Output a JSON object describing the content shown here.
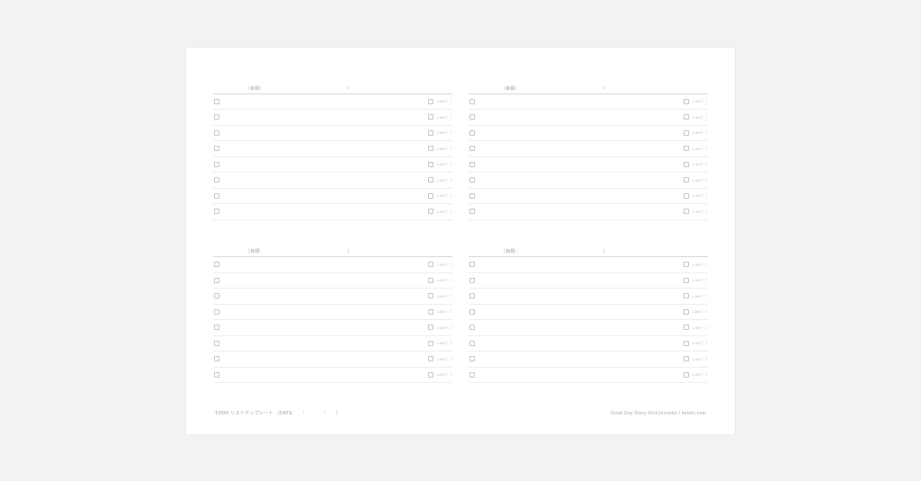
{
  "section_header": {
    "label": "（目標：",
    "close": "）"
  },
  "row": {
    "limit_label": "LIMIT",
    "slash": "/"
  },
  "rows_per_section": 8,
  "sections_count": 4,
  "footer": {
    "left_title": "TODO リストアップシート",
    "date_label": "（DATE",
    "slash": "/",
    "close": "）",
    "right": "Good Day Diary ©eiichiroishii / mitteli.com"
  }
}
